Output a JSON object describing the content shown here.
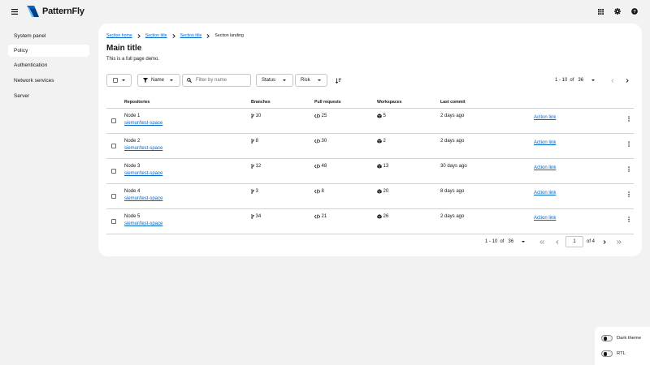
{
  "brand": {
    "name": "PatternFly"
  },
  "header": {
    "icons": [
      "grid-icon",
      "gear-icon",
      "help-icon"
    ]
  },
  "sidebar": {
    "items": [
      {
        "label": "System panel",
        "active": false
      },
      {
        "label": "Policy",
        "active": true
      },
      {
        "label": "Authentication",
        "active": false
      },
      {
        "label": "Network services",
        "active": false
      },
      {
        "label": "Server",
        "active": false
      }
    ]
  },
  "breadcrumb": {
    "items": [
      "Section home",
      "Section title",
      "Section title"
    ],
    "current": "Section landing"
  },
  "page": {
    "title": "Main title",
    "description": "This is a full page demo."
  },
  "toolbar": {
    "filter_attribute": "Name",
    "search_placeholder": "Filter by name",
    "status_label": "Status",
    "risk_label": "Risk"
  },
  "pagination": {
    "range": "1 - 10",
    "of": "of",
    "total": "36",
    "page": "1",
    "of_pages": "of 4"
  },
  "table": {
    "columns": [
      "Repositories",
      "Branches",
      "Pull requests",
      "Workspaces",
      "Last commit"
    ],
    "rows": [
      {
        "name": "Node 1",
        "repo": "siemur/test-space",
        "branches": "10",
        "pull_requests": "25",
        "workspaces": "5",
        "last_commit": "2 days ago",
        "action": "Action link"
      },
      {
        "name": "Node 2",
        "repo": "siemur/test-space",
        "branches": "8",
        "pull_requests": "30",
        "workspaces": "2",
        "last_commit": "2 days ago",
        "action": "Action link"
      },
      {
        "name": "Node 3",
        "repo": "siemur/test-space",
        "branches": "12",
        "pull_requests": "48",
        "workspaces": "13",
        "last_commit": "30 days ago",
        "action": "Action link"
      },
      {
        "name": "Node 4",
        "repo": "siemur/test-space",
        "branches": "3",
        "pull_requests": "8",
        "workspaces": "20",
        "last_commit": "8 days ago",
        "action": "Action link"
      },
      {
        "name": "Node 5",
        "repo": "siemur/test-space",
        "branches": "34",
        "pull_requests": "21",
        "workspaces": "26",
        "last_commit": "2 days ago",
        "action": "Action link"
      }
    ]
  },
  "theme": {
    "dark_label": "Dark theme",
    "rtl_label": "RTL"
  },
  "colors": {
    "link": "#0066cc",
    "background": "#f2f2f2",
    "surface": "#ffffff"
  }
}
